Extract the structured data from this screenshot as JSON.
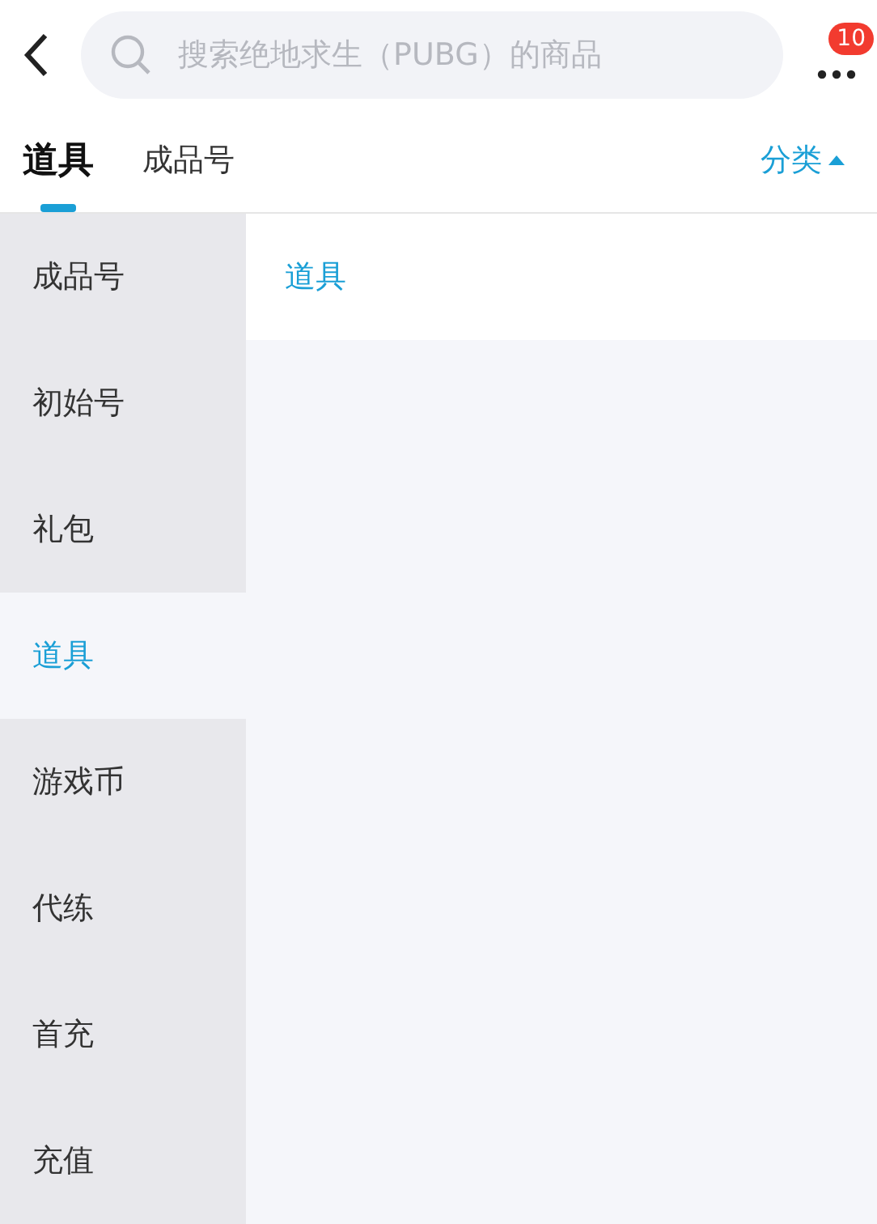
{
  "search": {
    "placeholder": "搜索绝地求生（PUBG）的商品"
  },
  "more": {
    "badge": "10"
  },
  "tabs": [
    {
      "label": "道具",
      "selected": true
    },
    {
      "label": "成品号",
      "selected": false
    }
  ],
  "category_toggle": {
    "label": "分类",
    "expanded": true
  },
  "sidebar": {
    "items": [
      {
        "label": "成品号",
        "selected": false
      },
      {
        "label": "初始号",
        "selected": false
      },
      {
        "label": "礼包",
        "selected": false
      },
      {
        "label": "道具",
        "selected": true
      },
      {
        "label": "游戏币",
        "selected": false
      },
      {
        "label": "代练",
        "selected": false
      },
      {
        "label": "首充",
        "selected": false
      },
      {
        "label": "充值",
        "selected": false
      }
    ]
  },
  "content": {
    "items": [
      "道具"
    ]
  }
}
